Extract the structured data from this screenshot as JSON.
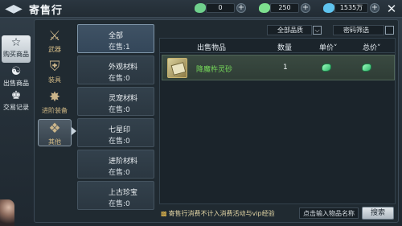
{
  "header": {
    "title": "寄售行",
    "currencies": [
      {
        "icon": "silver-ingot-icon",
        "value": "0",
        "color": "#6fd08c"
      },
      {
        "icon": "gold-ingot-icon",
        "value": "250",
        "color": "#7ee08f"
      },
      {
        "icon": "diamond-icon",
        "value": "1535万",
        "color": "#5fc4ef"
      }
    ]
  },
  "left_nav": [
    {
      "label": "购买商品",
      "icon": "buy-goods-icon",
      "active": true
    },
    {
      "label": "出售商品",
      "icon": "sell-goods-icon",
      "active": false
    },
    {
      "label": "交易记录",
      "icon": "trade-record-icon",
      "active": false
    }
  ],
  "categories": [
    {
      "label": "武器",
      "icon": "weapon-category-icon"
    },
    {
      "label": "装具",
      "icon": "armor-category-icon"
    },
    {
      "label": "进阶装备",
      "icon": "advanced-equip-category-icon"
    },
    {
      "label": "其他",
      "icon": "other-category-icon",
      "active": true
    }
  ],
  "subcategories": [
    {
      "name": "全部",
      "count": "在售:1",
      "active": true
    },
    {
      "name": "外观材料",
      "count": "在售:0"
    },
    {
      "name": "灵宠材料",
      "count": "在售:0"
    },
    {
      "name": "七星印",
      "count": "在售:0"
    },
    {
      "name": "进阶材料",
      "count": "在售:0"
    },
    {
      "name": "上古珍宝",
      "count": "在售:0"
    }
  ],
  "filters": {
    "quality": "全部品质",
    "password": "密码筛选"
  },
  "table": {
    "headers": {
      "item": "出售物品",
      "quantity": "数量",
      "unit_price": "单价",
      "total_price": "总价"
    },
    "rows": [
      {
        "name": "降魔杵灵砂",
        "quantity": "1",
        "unit_price_icon": "gem-icon",
        "total_price_icon": "gem-icon"
      }
    ]
  },
  "footer": {
    "notice": "寄售行消费不计入消费活动与vip经验",
    "search_placeholder": "点击输入物品名称",
    "search_button": "搜索"
  }
}
